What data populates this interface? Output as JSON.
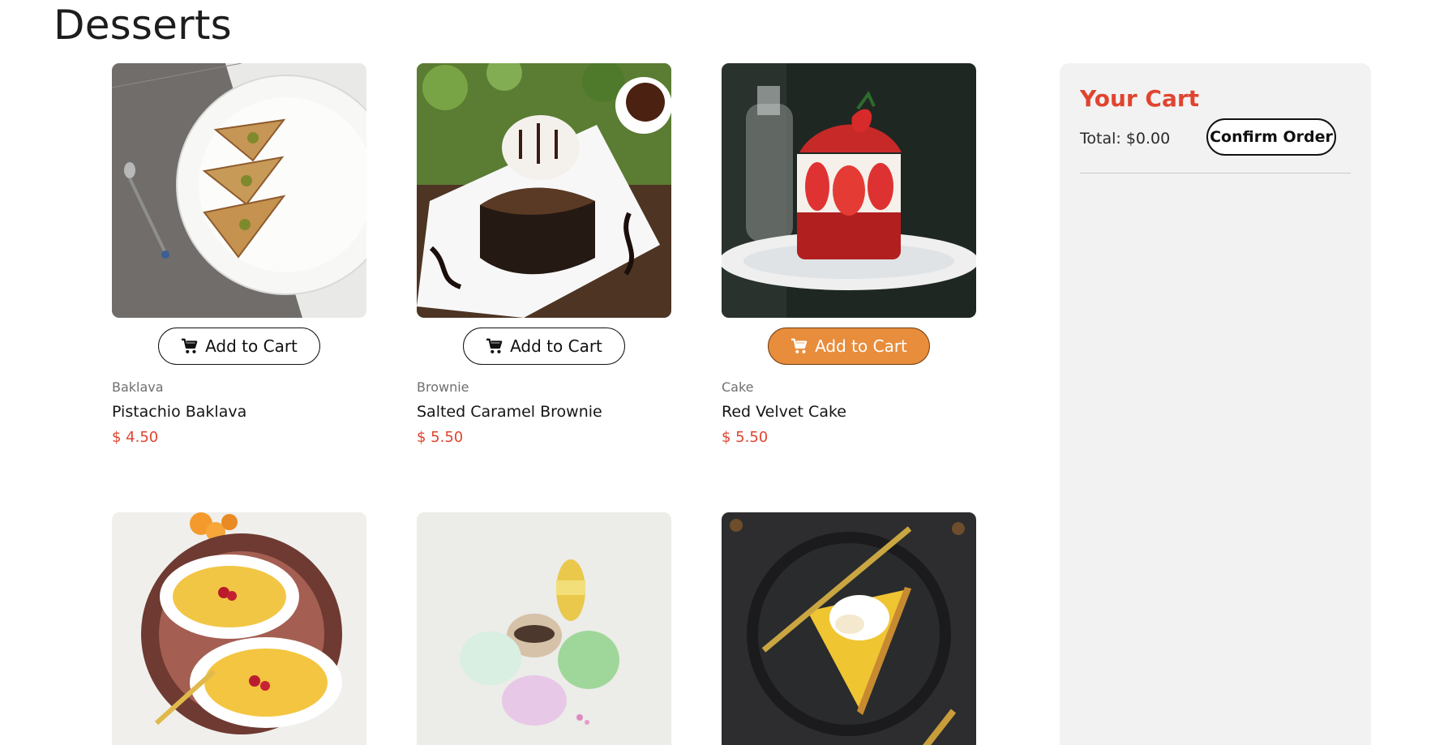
{
  "page": {
    "title": "Desserts"
  },
  "products": [
    {
      "category": "Baklava",
      "name": "Pistachio Baklava",
      "price": "$ 4.50",
      "button_label": "Add to Cart",
      "button_active": false
    },
    {
      "category": "Brownie",
      "name": "Salted Caramel Brownie",
      "price": "$ 5.50",
      "button_label": "Add to Cart",
      "button_active": false
    },
    {
      "category": "Cake",
      "name": "Red Velvet Cake",
      "price": "$ 5.50",
      "button_label": "Add to Cart",
      "button_active": true
    },
    {
      "category": "",
      "name": "",
      "price": "",
      "button_label": "",
      "button_active": false
    },
    {
      "category": "",
      "name": "",
      "price": "",
      "button_label": "",
      "button_active": false
    },
    {
      "category": "",
      "name": "",
      "price": "",
      "button_label": "",
      "button_active": false
    }
  ],
  "cart": {
    "title": "Your Cart",
    "total": "Total: $0.00",
    "confirm_label": "Confirm Order"
  },
  "colors": {
    "accent": "#e0442f",
    "active_button": "#e88d3c",
    "cart_background": "#f2f2f2"
  },
  "icons": {
    "add_to_cart": "shopping-cart-icon"
  }
}
